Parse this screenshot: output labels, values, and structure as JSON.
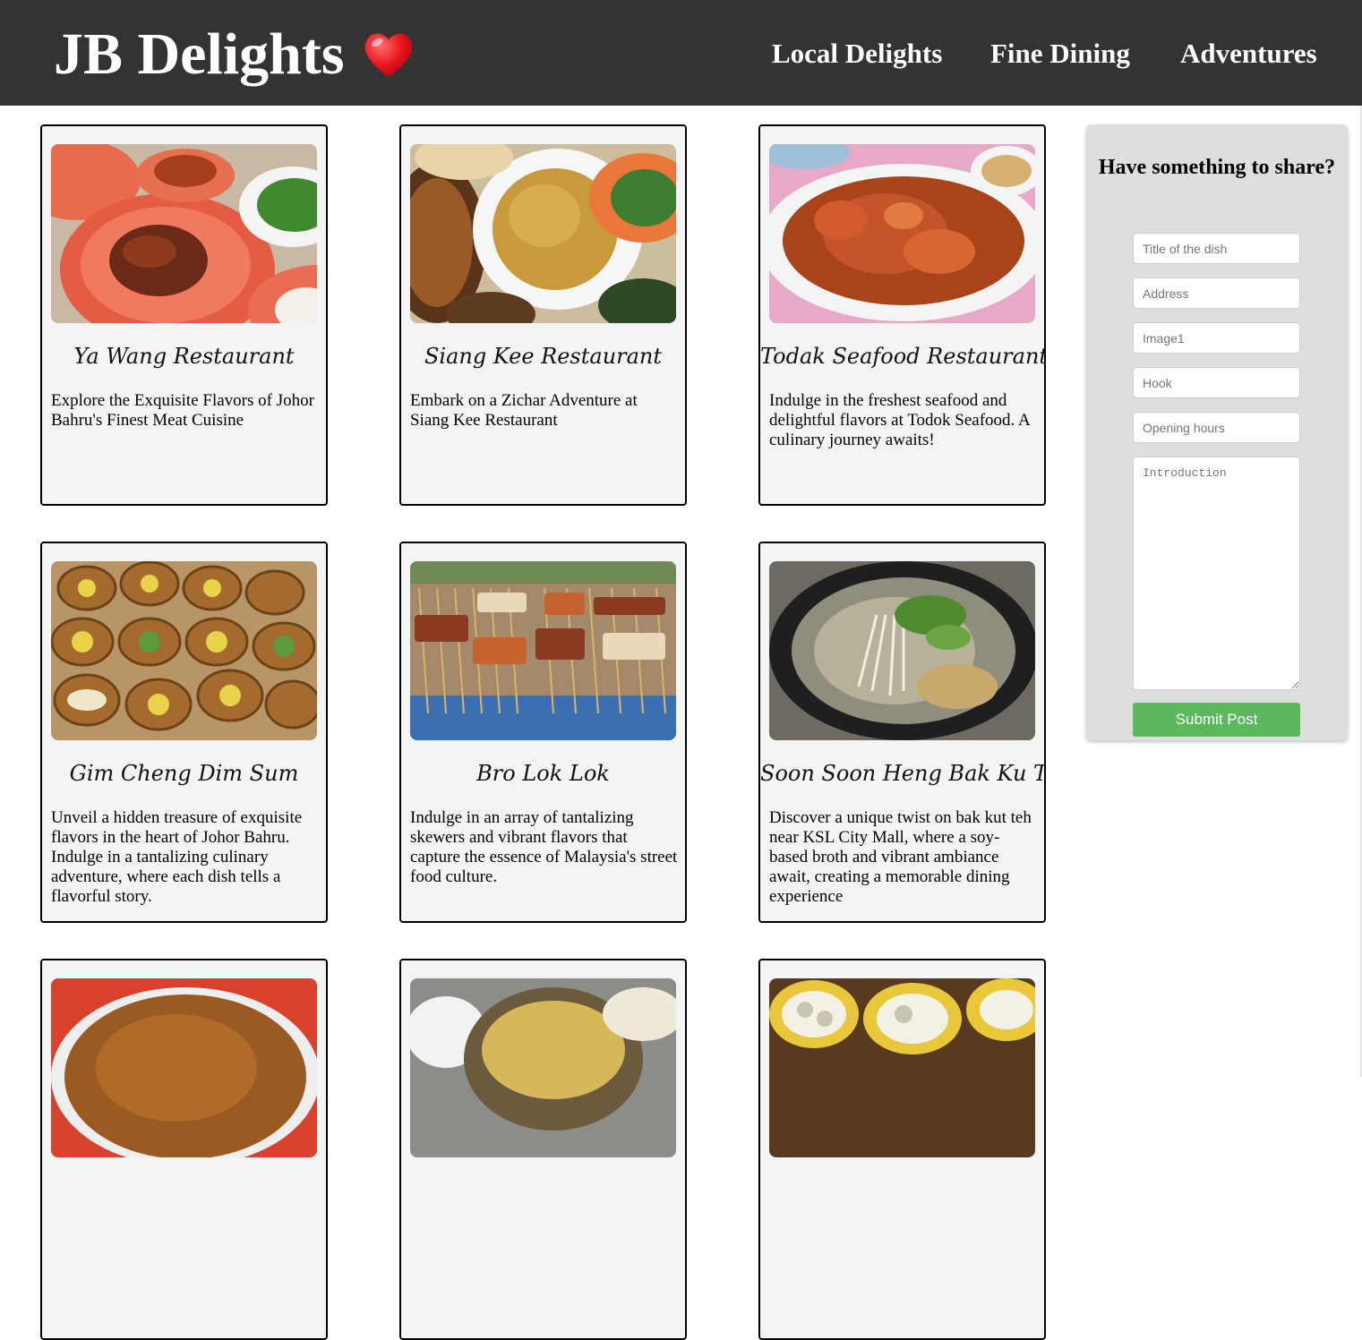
{
  "header": {
    "brand": "JB Delights",
    "brand_icon": "heart-icon",
    "nav": [
      "Local Delights",
      "Fine Dining",
      "Adventures"
    ]
  },
  "cards": [
    {
      "title": "Ya Wang Restaurant",
      "description": "Explore the Exquisite Flavors of Johor Bahru's Finest Meat Cuisine",
      "image": "roast-duck-photo"
    },
    {
      "title": "Siang Kee Restaurant",
      "description": "Embark on a Zichar Adventure at Siang Kee Restaurant",
      "image": "zichar-dishes-photo"
    },
    {
      "title": "Todak Seafood Restaurant",
      "description": "Indulge in the freshest seafood and delightful flavors at Todok Seafood. A culinary journey awaits!",
      "image": "chili-crab-photo"
    },
    {
      "title": "Gim Cheng Dim Sum",
      "description": "Unveil a hidden treasure of exquisite flavors in the heart of Johor Bahru. Indulge in a tantalizing culinary adventure, where each dish tells a flavorful story.",
      "image": "dim-sum-photo"
    },
    {
      "title": "Bro Lok Lok",
      "description": "Indulge in an array of tantalizing skewers and vibrant flavors that capture the essence of Malaysia's street food culture.",
      "image": "lok-lok-skewers-photo"
    },
    {
      "title": "Soon Soon Heng Bak Ku Teh",
      "description": "Discover a unique twist on bak kut teh near KSL City Mall, where a soy-based broth and vibrant ambiance await, creating a memorable dining experience",
      "image": "bak-kut-teh-photo"
    },
    {
      "title": "",
      "description": "",
      "image": "fried-noodles-photo"
    },
    {
      "title": "",
      "description": "",
      "image": "claypot-rice-photo"
    },
    {
      "title": "",
      "description": "",
      "image": "dim-sum-baskets-photo"
    }
  ],
  "share_form": {
    "title": "Have something to share?",
    "placeholders": {
      "dish_title": "Title of the dish",
      "address": "Address",
      "image": "Image1",
      "hook": "Hook",
      "opening_hours": "Opening hours",
      "introduction": "Introduction"
    },
    "submit_label": "Submit Post"
  },
  "colors": {
    "header_bg": "#333333",
    "card_bg": "#f4f4f4",
    "panel_bg": "#dedede",
    "submit_bg": "#5cb85c"
  }
}
